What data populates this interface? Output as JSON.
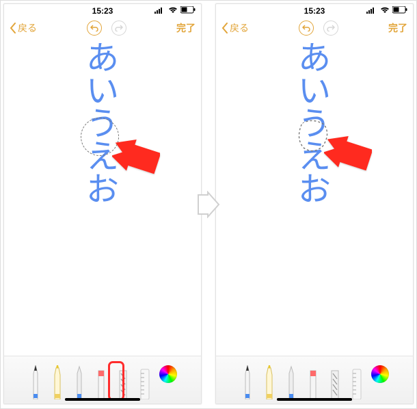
{
  "statusbar": {
    "time": "15:23"
  },
  "nav": {
    "back": "戻る",
    "done": "完了"
  },
  "handwriting": {
    "ch1": "あ",
    "ch2": "い",
    "ch3": "う",
    "ch4": "え",
    "ch5": "お"
  },
  "colors": {
    "accent": "#e2a53a",
    "ink": "#5a8ef0",
    "arrow": "#ff2a1f"
  }
}
